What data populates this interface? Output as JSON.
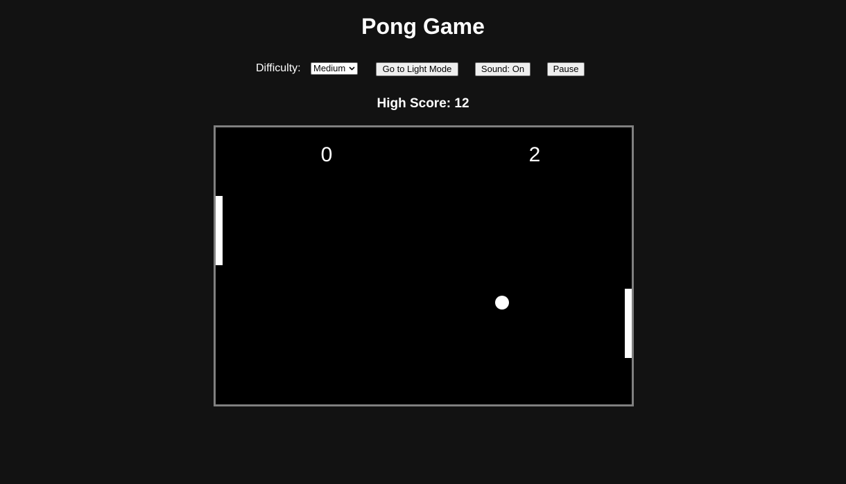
{
  "page": {
    "title": "Pong Game"
  },
  "controls": {
    "difficulty_label": "Difficulty:",
    "difficulty_selected": "Medium",
    "mode_button": "Go to Light Mode",
    "sound_button": "Sound: On",
    "pause_button": "Pause"
  },
  "high_score": {
    "text": "High Score: 12"
  },
  "game": {
    "left_score": "0",
    "right_score": "2"
  },
  "colors": {
    "background": "#121212",
    "board": "#000000",
    "board_border": "#808080",
    "foreground": "#ffffff"
  }
}
